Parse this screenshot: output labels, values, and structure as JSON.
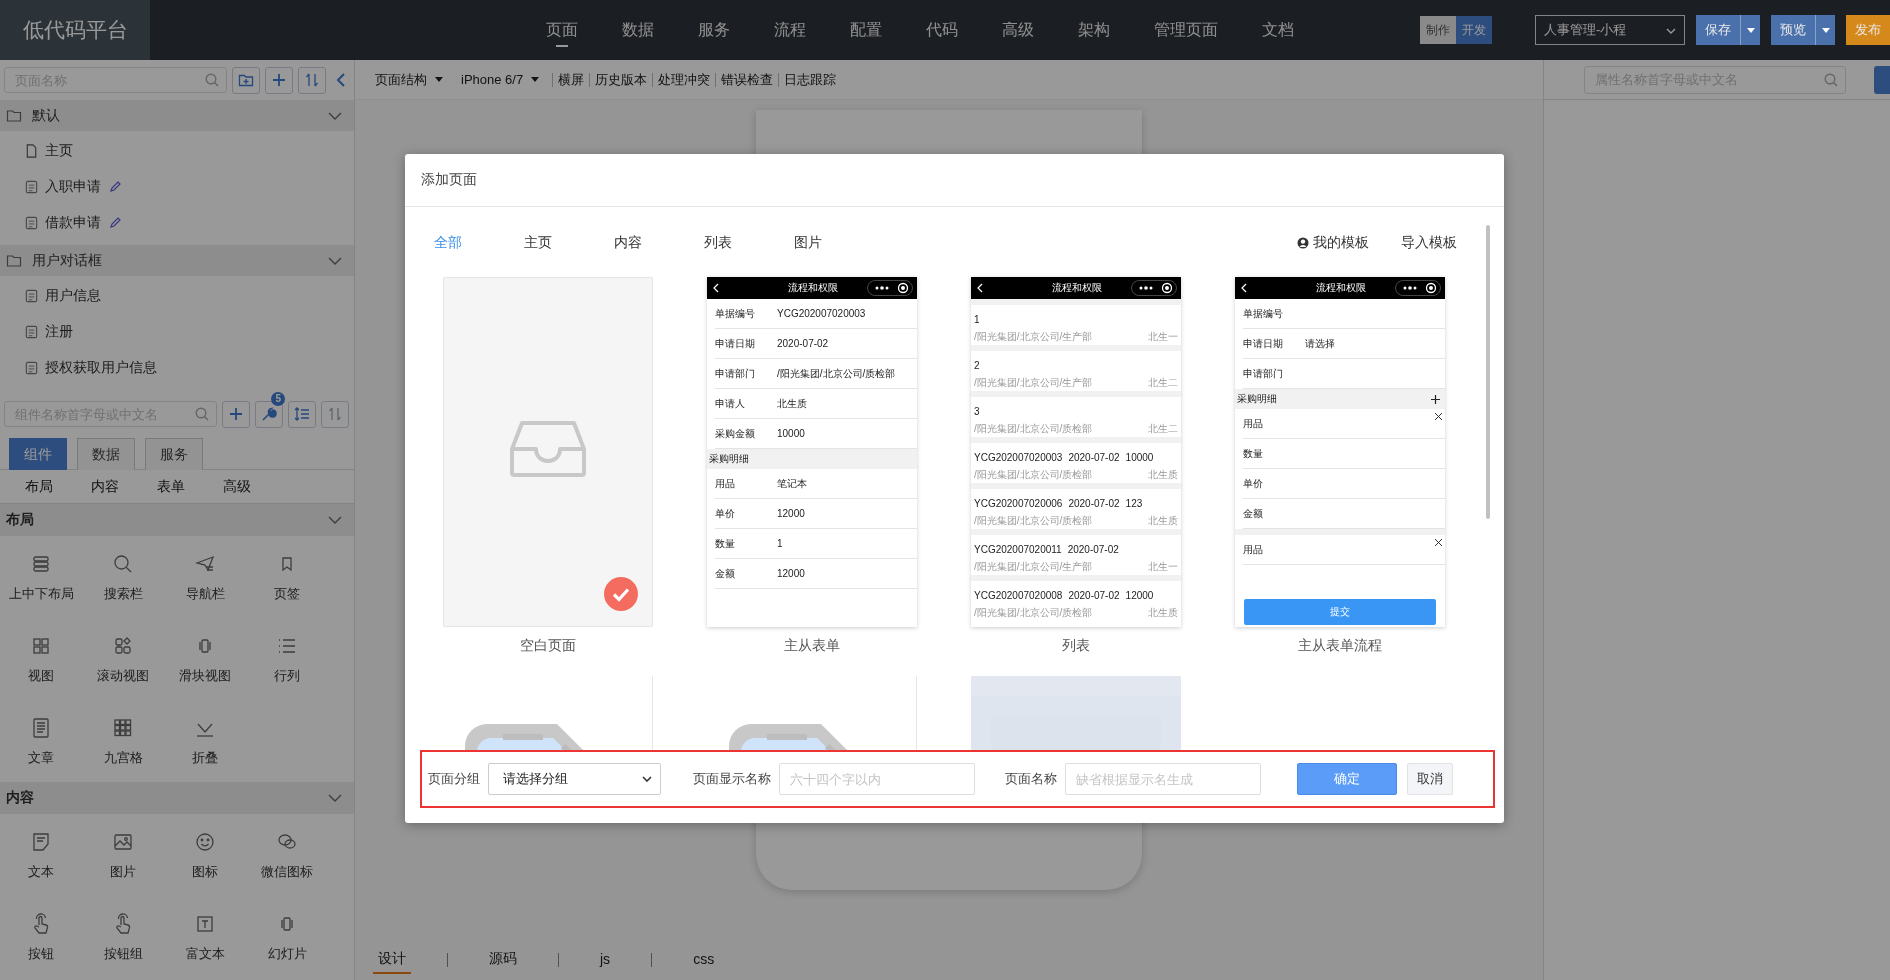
{
  "header": {
    "logo": "低代码平台",
    "nav": [
      {
        "label": "页面",
        "selected": true
      },
      {
        "label": "数据",
        "selected": false
      },
      {
        "label": "服务",
        "selected": false
      },
      {
        "label": "流程",
        "selected": false
      },
      {
        "label": "配置",
        "selected": false
      },
      {
        "label": "代码",
        "selected": false
      },
      {
        "label": "高级",
        "selected": false
      },
      {
        "label": "架构",
        "selected": false
      },
      {
        "label": "管理页面",
        "selected": false
      },
      {
        "label": "文档",
        "selected": false
      }
    ],
    "mode_switch": [
      {
        "label": "制作",
        "selected": false
      },
      {
        "label": "开发",
        "selected": true
      }
    ],
    "project_select": {
      "value": "人事管理-小程"
    },
    "actions": [
      {
        "label": "保存",
        "kind": "split",
        "color": "#4a71ab"
      },
      {
        "label": "预览",
        "kind": "split",
        "color": "#4a71ab"
      },
      {
        "label": "发布",
        "kind": "single",
        "color": "#d6891b"
      }
    ]
  },
  "page_tree": {
    "search_placeholder": "页面名称",
    "groups": [
      {
        "label": "默认",
        "expanded": true,
        "children": [
          {
            "label": "主页",
            "kind": "home",
            "editable": false
          },
          {
            "label": "入职申请",
            "kind": "page",
            "editable": true
          },
          {
            "label": "借款申请",
            "kind": "page",
            "editable": true
          }
        ]
      },
      {
        "label": "用户对话框",
        "expanded": true,
        "children": [
          {
            "label": "用户信息",
            "kind": "page",
            "editable": false
          },
          {
            "label": "注册",
            "kind": "page",
            "editable": false
          },
          {
            "label": "授权获取用户信息",
            "kind": "page",
            "editable": false
          }
        ]
      }
    ]
  },
  "component_panel": {
    "search_placeholder": "组件名称首字母或中文名",
    "badge": "5",
    "tabs": [
      {
        "label": "组件",
        "selected": true
      },
      {
        "label": "数据",
        "selected": false
      },
      {
        "label": "服务",
        "selected": false
      }
    ],
    "categories": [
      "布局",
      "内容",
      "表单",
      "高级"
    ],
    "sections": [
      {
        "title": "布局",
        "expanded": true,
        "items": [
          "上中下布局",
          "搜索栏",
          "导航栏",
          "页签",
          "视图",
          "滚动视图",
          "滑块视图",
          "行列",
          "文章",
          "九宫格",
          "折叠"
        ]
      },
      {
        "title": "内容",
        "expanded": true,
        "items": [
          "文本",
          "图片",
          "图标",
          "微信图标",
          "按钮",
          "按钮组",
          "富文本",
          "幻灯片"
        ]
      }
    ]
  },
  "toolbar": [
    {
      "label": "页面结构",
      "kind": "dropdown"
    },
    {
      "label": "iPhone 6/7",
      "kind": "dropdown"
    },
    {
      "label": "横屏",
      "kind": "action"
    },
    {
      "label": "历史版本",
      "kind": "action"
    },
    {
      "label": "处理冲突",
      "kind": "action"
    },
    {
      "label": "错误检查",
      "kind": "action"
    },
    {
      "label": "日志跟踪",
      "kind": "action"
    }
  ],
  "properties_panel": {
    "search_placeholder": "属性名称首字母或中文名"
  },
  "editor_tabs": [
    {
      "label": "设计",
      "selected": true
    },
    {
      "label": "源码",
      "selected": false
    },
    {
      "label": "js",
      "selected": false
    },
    {
      "label": "css",
      "selected": false
    }
  ],
  "dialog": {
    "title": "添加页面",
    "tabs": [
      {
        "label": "全部",
        "selected": true
      },
      {
        "label": "主页",
        "selected": false
      },
      {
        "label": "内容",
        "selected": false
      },
      {
        "label": "列表",
        "selected": false
      },
      {
        "label": "图片",
        "selected": false
      }
    ],
    "links": [
      {
        "label": "我的模板",
        "kind": "user"
      },
      {
        "label": "导入模板",
        "kind": "plain"
      }
    ],
    "templates": [
      {
        "name": "空白页面",
        "kind": "blank",
        "selected": true
      },
      {
        "name": "主从表单",
        "kind": "form",
        "selected": false,
        "preview": {
          "title": "流程和权限",
          "rows": [
            {
              "kind": "field",
              "label": "单据编号",
              "value": "YCG202007020003"
            },
            {
              "kind": "field",
              "label": "申请日期",
              "value": "2020-07-02"
            },
            {
              "kind": "field",
              "label": "申请部门",
              "value": "/阳光集团/北京公司/质检部"
            },
            {
              "kind": "field",
              "label": "申请人",
              "value": "北生质"
            },
            {
              "kind": "field",
              "label": "采购金额",
              "value": "10000"
            },
            {
              "kind": "section",
              "label": "采购明细"
            },
            {
              "kind": "field",
              "label": "用品",
              "value": "笔记本"
            },
            {
              "kind": "field",
              "label": "单价",
              "value": "12000"
            },
            {
              "kind": "field",
              "label": "数量",
              "value": "1"
            },
            {
              "kind": "field",
              "label": "金额",
              "value": "12000"
            }
          ]
        }
      },
      {
        "name": "列表",
        "kind": "list",
        "selected": false,
        "preview": {
          "title": "流程和权限",
          "items": [
            {
              "cols": [
                "1"
              ],
              "path": "/阳光集团/北京公司/生产部",
              "person": "北生一"
            },
            {
              "cols": [
                "2"
              ],
              "path": "/阳光集团/北京公司/生产部",
              "person": "北生二"
            },
            {
              "cols": [
                "3"
              ],
              "path": "/阳光集团/北京公司/质检部",
              "person": "北生二"
            },
            {
              "cols": [
                "YCG202007020003",
                "2020-07-02",
                "10000"
              ],
              "path": "/阳光集团/北京公司/质检部",
              "person": "北生质"
            },
            {
              "cols": [
                "YCG202007020006",
                "2020-07-02",
                "123"
              ],
              "path": "/阳光集团/北京公司/质检部",
              "person": "北生质"
            },
            {
              "cols": [
                "YCG202007020011",
                "2020-07-02"
              ],
              "path": "/阳光集团/北京公司/生产部",
              "person": "北生一"
            },
            {
              "cols": [
                "YCG202007020008",
                "2020-07-02",
                "12000"
              ],
              "path": "/阳光集团/北京公司/质检部",
              "person": "北生质"
            }
          ]
        }
      },
      {
        "name": "主从表单流程",
        "kind": "form",
        "selected": false,
        "preview": {
          "title": "流程和权限",
          "rows": [
            {
              "kind": "field",
              "label": "单据编号"
            },
            {
              "kind": "field",
              "label": "申请日期",
              "value": "请选择"
            },
            {
              "kind": "field",
              "label": "申请部门"
            },
            {
              "kind": "section",
              "label": "采购明细",
              "addable": true
            },
            {
              "kind": "field",
              "label": "用品",
              "removable": true
            },
            {
              "kind": "field",
              "label": "数量"
            },
            {
              "kind": "field",
              "label": "单价"
            },
            {
              "kind": "field",
              "label": "金额"
            },
            {
              "kind": "gap"
            },
            {
              "kind": "field",
              "label": "用品",
              "removable": true
            }
          ],
          "submit": "提交"
        }
      }
    ],
    "form": {
      "fields": [
        {
          "label": "页面分组",
          "kind": "select",
          "value": "请选择分组"
        },
        {
          "label": "页面显示名称",
          "kind": "text",
          "placeholder": "六十四个字以内"
        },
        {
          "label": "页面名称",
          "kind": "text",
          "placeholder": "缺省根据显示名生成"
        }
      ],
      "buttons": [
        {
          "label": "确定",
          "kind": "primary"
        },
        {
          "label": "取消",
          "kind": "secondary"
        }
      ]
    }
  }
}
